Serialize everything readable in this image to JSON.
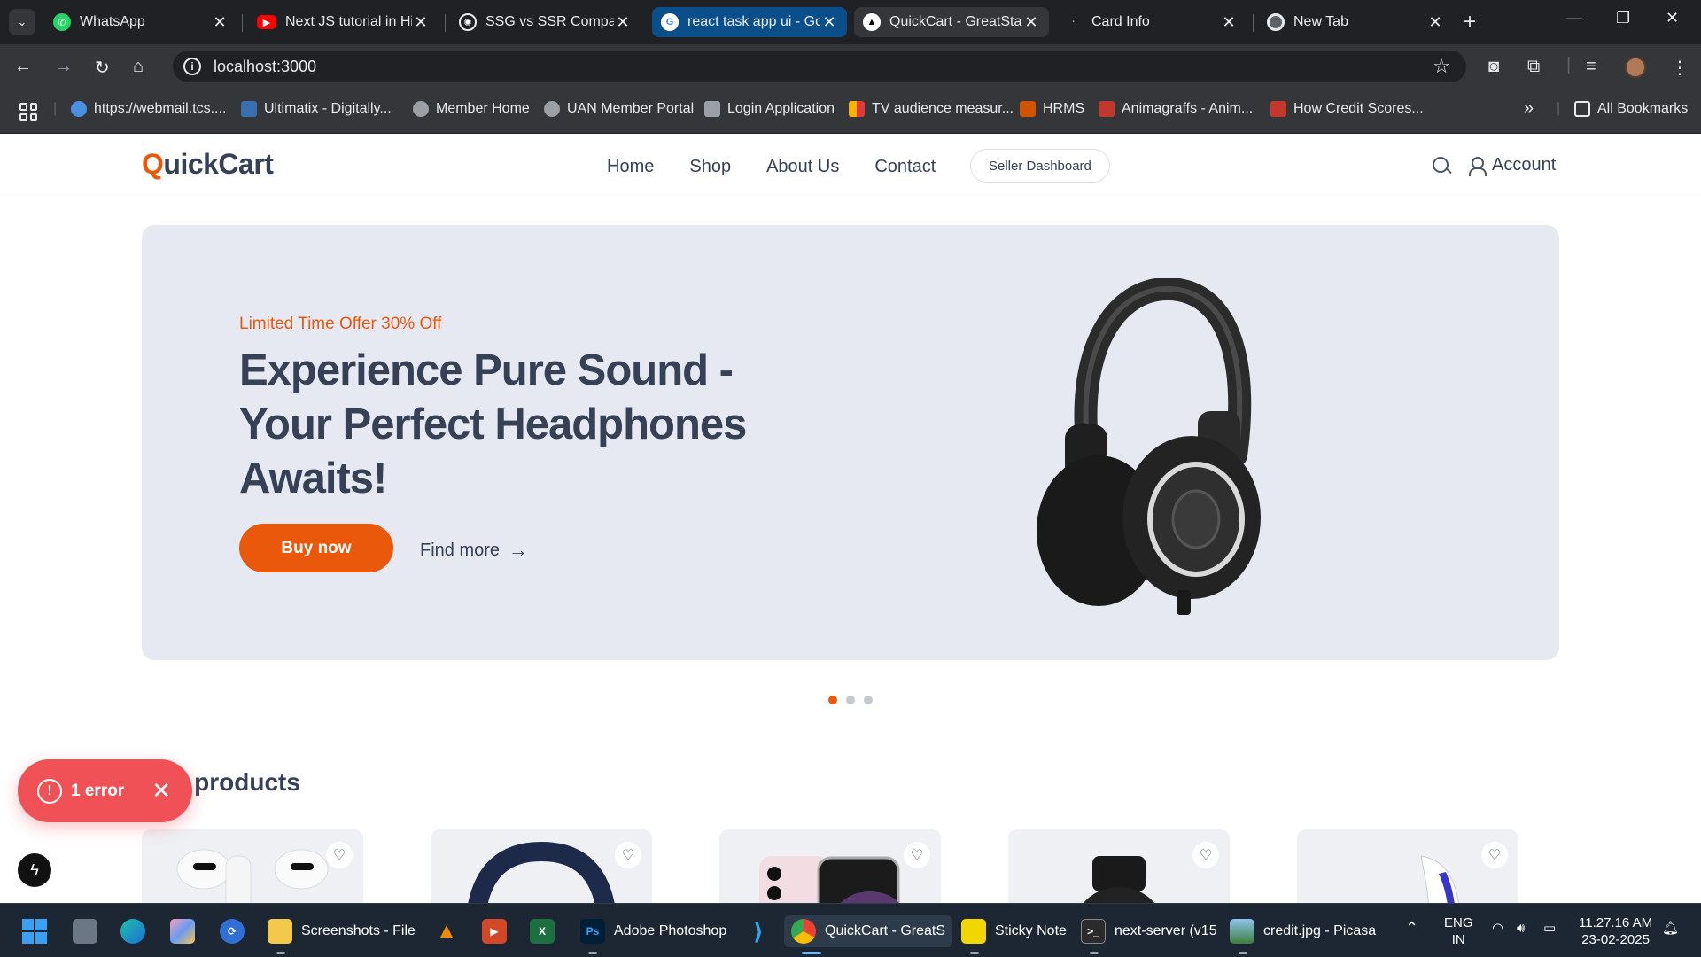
{
  "browser": {
    "tabs": [
      {
        "title": "WhatsApp",
        "icon": "whatsapp-icon",
        "color": "#25d366",
        "state": "normal"
      },
      {
        "title": "Next JS tutorial in Hin",
        "icon": "youtube-icon",
        "color": "#ff0000",
        "state": "normal"
      },
      {
        "title": "SSG vs SSR Comparis",
        "icon": "chatgpt-icon",
        "color": "#e8eaed",
        "state": "normal"
      },
      {
        "title": "react task app ui - Go",
        "icon": "google-icon",
        "color": "#4285f4",
        "state": "highlighted"
      },
      {
        "title": "QuickCart - GreatStac",
        "icon": "triangle-icon",
        "color": "#ffffff",
        "state": "active"
      },
      {
        "title": "Card Info",
        "icon": "loading-icon",
        "color": "#5f6368",
        "state": "normal"
      },
      {
        "title": "New Tab",
        "icon": "chrome-icon",
        "color": "#e8eaed",
        "state": "normal"
      }
    ],
    "url": "localhost:3000",
    "bookmarks": [
      {
        "label": "https://webmail.tcs....",
        "color": "#4a90e2"
      },
      {
        "label": "Ultimatix - Digitally...",
        "color": "#3a6fb0"
      },
      {
        "label": "Member Home",
        "color": "#9aa0a6"
      },
      {
        "label": "UAN Member Portal",
        "color": "#9aa0a6"
      },
      {
        "label": "Login Application",
        "color": "#9aa0a6"
      },
      {
        "label": "TV audience measur...",
        "color": "#f4b400"
      },
      {
        "label": "HRMS",
        "color": "#d35400"
      },
      {
        "label": "Animagraffs - Anim...",
        "color": "#c0392b"
      },
      {
        "label": "How Credit Scores...",
        "color": "#c0392b"
      }
    ],
    "all_bookmarks_label": "All Bookmarks",
    "overflow_label": "»"
  },
  "site": {
    "logo_first": "Q",
    "logo_rest": "uickCart",
    "nav": [
      "Home",
      "Shop",
      "About Us",
      "Contact"
    ],
    "seller_dashboard": "Seller Dashboard",
    "account": "Account",
    "hero": {
      "offer": "Limited Time Offer 30% Off",
      "title": "Experience Pure Sound - Your Perfect Headphones Awaits!",
      "buy_now": "Buy now",
      "find_more": "Find more",
      "slides_count": 3,
      "active_slide": 0
    },
    "popular_heading": "ular products",
    "product_cards": [
      "earbuds",
      "headphones",
      "phone",
      "smartwatch",
      "console"
    ]
  },
  "dev_overlay": {
    "error_label": "1 error"
  },
  "taskbar": {
    "items": [
      {
        "label": "Screenshots - File",
        "icon": "folder-icon",
        "color": "#f2c94c"
      },
      {
        "label": "Adobe Photoshop",
        "icon": "photoshop-icon",
        "color": "#001e36"
      },
      {
        "label": "QuickCart - GreatS",
        "icon": "chrome-icon",
        "color": "#4285f4"
      },
      {
        "label": "Sticky Note",
        "icon": "sticky-notes-icon",
        "color": "#f2d600"
      },
      {
        "label": "next-server (v15",
        "icon": "terminal-icon",
        "color": "#2b2b2b"
      },
      {
        "label": "credit.jpg - Picasa",
        "icon": "picasa-icon",
        "color": "#5b8fd1"
      }
    ],
    "lang_top": "ENG",
    "lang_bottom": "IN",
    "time": "11.27.16 AM",
    "date": "23-02-2025"
  }
}
